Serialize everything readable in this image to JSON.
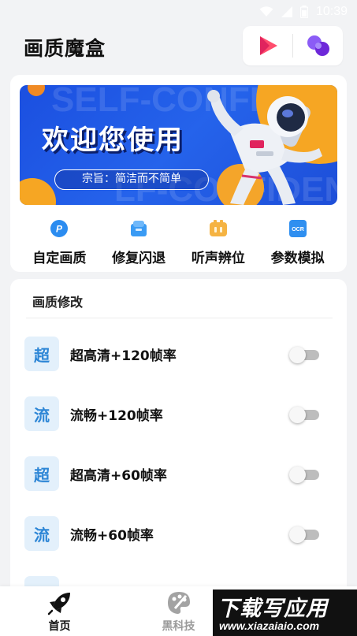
{
  "status_bar": {
    "time": "10:39"
  },
  "header": {
    "title": "画质魔盒"
  },
  "banner": {
    "title": "欢迎您使用",
    "subtitle": "宗旨：简洁而不简单",
    "bg_text_1": "SELF-CONFID",
    "bg_text_2": "LF-CONFIDEN"
  },
  "quick_actions": [
    {
      "label": "自定画质",
      "icon": "p-circle-icon",
      "color": "#2b8cf0"
    },
    {
      "label": "修复闪退",
      "icon": "repair-box-icon",
      "color": "#3a9bf4"
    },
    {
      "label": "听声辨位",
      "icon": "audio-box-icon",
      "color": "#f5b342"
    },
    {
      "label": "参数模拟",
      "icon": "ocr-icon",
      "color": "#2f8ff0"
    }
  ],
  "section": {
    "title": "画质修改",
    "items": [
      {
        "badge": "超",
        "label": "超高清+120帧率",
        "enabled": false
      },
      {
        "badge": "流",
        "label": "流畅+120帧率",
        "enabled": false
      },
      {
        "badge": "超",
        "label": "超高清+60帧率",
        "enabled": false
      },
      {
        "badge": "流",
        "label": "流畅+60帧率",
        "enabled": false
      }
    ]
  },
  "bottom_nav": [
    {
      "label": "首页",
      "icon": "rocket-icon",
      "active": true
    },
    {
      "label": "黑科技",
      "icon": "palette-icon",
      "active": false
    }
  ],
  "watermark": {
    "main": "下载写应用",
    "url": "www.xiazaiaio.com"
  },
  "colors": {
    "accent": "#2d86d6",
    "banner_blue": "#1d4ed8",
    "orange": "#f6a623"
  }
}
